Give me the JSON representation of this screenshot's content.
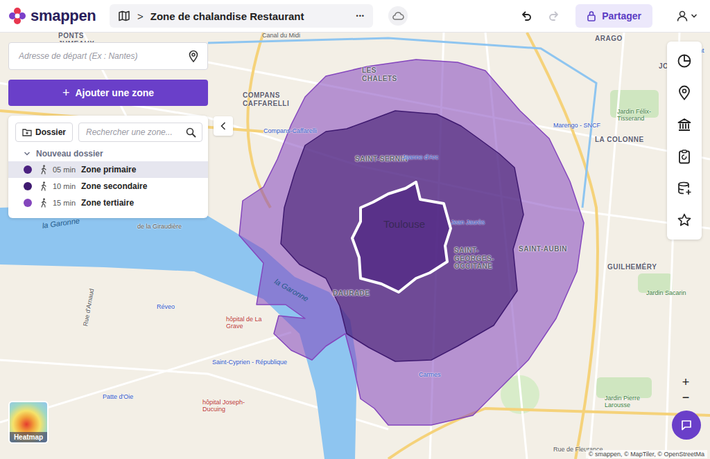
{
  "app": {
    "logo": "smappen"
  },
  "breadcrumb": {
    "separator": ">",
    "title": "Zone de chalandise Restaurant",
    "more": "•••"
  },
  "toolbar": {
    "undo_disabled": false,
    "redo_disabled": true,
    "share": "Partager"
  },
  "search_address": {
    "placeholder": "Adresse de départ (Ex : Nantes)"
  },
  "add_zone": {
    "icon": "+",
    "label": "Ajouter une zone"
  },
  "zone_panel": {
    "folder_button": "Dossier",
    "search_placeholder": "Rechercher une zone...",
    "folders": [
      {
        "name": "Nouveau dossier",
        "expanded": true,
        "zones": [
          {
            "time": "05 min",
            "name": "Zone primaire",
            "color": "#4b2180",
            "selected": true
          },
          {
            "time": "10 min",
            "name": "Zone secondaire",
            "color": "#3f1a70",
            "selected": false
          },
          {
            "time": "15 min",
            "name": "Zone tertiaire",
            "color": "#8446bd",
            "selected": false
          }
        ]
      }
    ]
  },
  "map": {
    "labels": [
      {
        "text": "Canal du Midi",
        "kind": "street"
      },
      {
        "text": "ARAGO",
        "kind": "district"
      },
      {
        "text": "Jolimont",
        "kind": "station"
      },
      {
        "text": "JOLIM",
        "kind": "district"
      },
      {
        "text": "LES CHALETS",
        "kind": "district"
      },
      {
        "text": "COMPANS CAFFARELLI",
        "kind": "district"
      },
      {
        "text": "Compans-Caffarelli",
        "kind": "station"
      },
      {
        "text": "SAINT-SERNIN",
        "kind": "district"
      },
      {
        "text": "Jeanne d'Arc",
        "kind": "station"
      },
      {
        "text": "Marengo - SNCF",
        "kind": "station"
      },
      {
        "text": "Jardin Félix-Tisserand",
        "kind": "park"
      },
      {
        "text": "LA COLONNE",
        "kind": "district"
      },
      {
        "text": "Toulouse",
        "kind": "city"
      },
      {
        "text": "Jean Jaurès",
        "kind": "station"
      },
      {
        "text": "SAINT-AUBIN",
        "kind": "district"
      },
      {
        "text": "SAINT-GEORGES-OCCITANE",
        "kind": "district"
      },
      {
        "text": "GUILHEMÉRY",
        "kind": "district"
      },
      {
        "text": "Jardin Sacarin",
        "kind": "park"
      },
      {
        "text": "la Garonne",
        "kind": "water"
      },
      {
        "text": "la Garonne",
        "kind": "water"
      },
      {
        "text": "de la Giraudière",
        "kind": "street"
      },
      {
        "text": "DAURADE",
        "kind": "district"
      },
      {
        "text": "hôpital de La Grave",
        "kind": "place"
      },
      {
        "text": "Réveo",
        "kind": "station"
      },
      {
        "text": "Rue d'Arnaud",
        "kind": "street"
      },
      {
        "text": "Saint-Cyprien - République",
        "kind": "station"
      },
      {
        "text": "Patte d'Oie",
        "kind": "station"
      },
      {
        "text": "hôpital Joseph-Ducuing",
        "kind": "place"
      },
      {
        "text": "Carmes",
        "kind": "station"
      },
      {
        "text": "Jardin Pierre Larousse",
        "kind": "park"
      },
      {
        "text": "Rue de Fleurance",
        "kind": "street"
      },
      {
        "text": "PONTS JUMEAUX",
        "kind": "district"
      }
    ]
  },
  "heatmap": {
    "label": "Heatmap"
  },
  "zoom": {
    "in": "+",
    "out": "−"
  },
  "attribution": "© smappen, © MapTiler, © OpenStreetMa"
}
